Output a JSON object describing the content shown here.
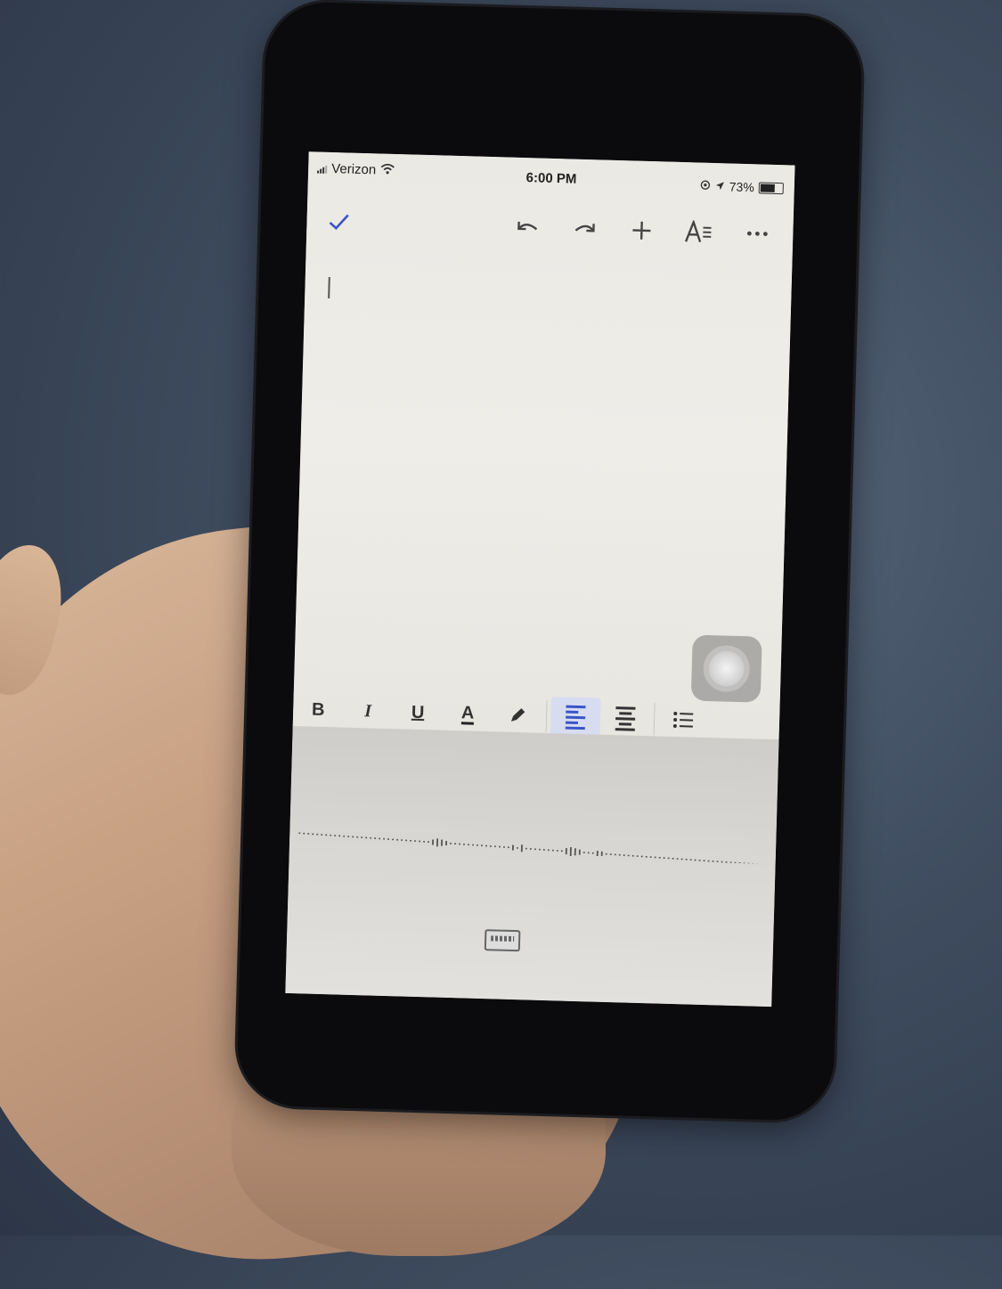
{
  "status_bar": {
    "carrier": "Verizon",
    "time": "6:00 PM",
    "battery": "73%",
    "battery_level": 0.73
  },
  "toolbar": {
    "done_icon": "checkmark-icon",
    "undo_icon": "undo-icon",
    "redo_icon": "redo-icon",
    "insert_icon": "plus-icon",
    "format_icon": "text-format-icon",
    "more_icon": "more-icon"
  },
  "format_bar": {
    "bold": "B",
    "italic": "I",
    "underline": "U",
    "text_color": "A",
    "active_alignment": "left"
  },
  "colors": {
    "accent": "#3a55c7",
    "active_bg": "#d7dcf1"
  }
}
